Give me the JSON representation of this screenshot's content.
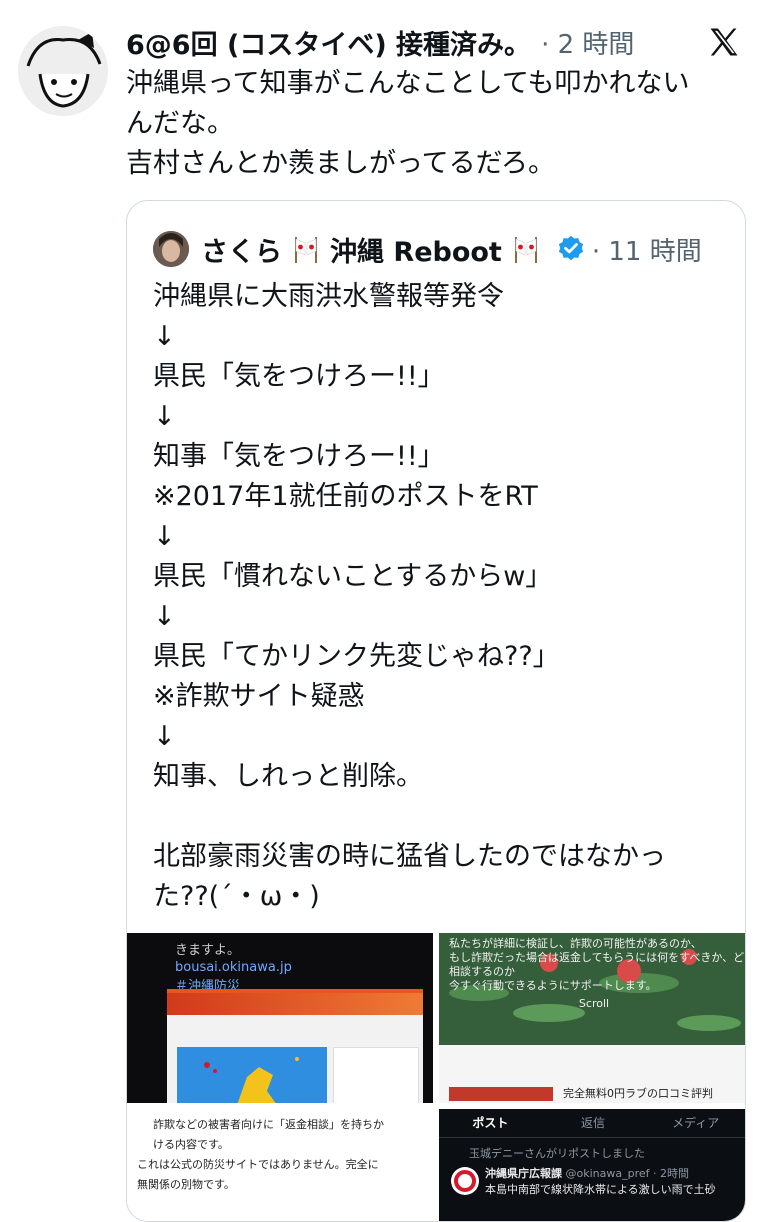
{
  "tweet": {
    "author": "6@6回 (コスタイベ) 接種済み。",
    "time": "· 2 時間",
    "lines": [
      "沖縄県って知事がこんなことしても叩かれない",
      "んだな。",
      "吉村さんとか羨ましがってるだろ。"
    ]
  },
  "quote": {
    "author": "さくら",
    "author_suffix": "沖縄 Reboot",
    "time": "· 11 時間",
    "lines": [
      "沖縄県に大雨洪水警報等発令",
      "↓",
      "県民「気をつけろー!!」",
      "↓",
      "知事「気をつけろー!!」",
      "※2017年1就任前のポストをRT",
      "↓",
      "県民「慣れないことするからw」",
      "↓",
      "県民「てかリンク先変じゃね??」",
      "※詐欺サイト疑惑",
      "↓",
      "知事、しれっと削除。",
      "",
      "北部豪雨災害の時に猛省したのではなかっ",
      "た??(´・ω・)"
    ]
  },
  "media": {
    "tile1": {
      "line1": "きますよ。",
      "link1": "bousai.okinawa.jp",
      "link2": "＃沖縄防災"
    },
    "tile2": {
      "lines": [
        "私たちが詳細に検証し、詐欺の可能性があるのか、",
        "もし詐欺だった場合は返金してもらうには何をすべきか、どこに",
        "相談するのか",
        "今すぐ行動できるようにサポートします。"
      ],
      "scroll": "Scroll",
      "caption": "完全無料0円ラブの口コミ評判"
    },
    "tile3": {
      "lines": [
        "詐欺などの被害者向けに「返金相談」を持ちか",
        "ける内容です。",
        "これは公式の防災サイトではありません。完全に",
        "無関係の別物です。"
      ]
    },
    "tile4": {
      "tabs": [
        "ポスト",
        "返信",
        "メディア"
      ],
      "repost": "玉城デニーさんがリポストしました",
      "name": "沖縄県庁広報課",
      "handle": "@okinawa_pref · 2時間",
      "text": "本島中南部で線状降水帯による激しい雨で土砂"
    }
  },
  "colors": {
    "text": "#0f1419",
    "muted": "#536471",
    "verified": "#1d9bf0",
    "border": "#cfd9de"
  },
  "icons": [
    "x-logo-icon",
    "japan-flag-icon",
    "verified-badge-icon"
  ]
}
